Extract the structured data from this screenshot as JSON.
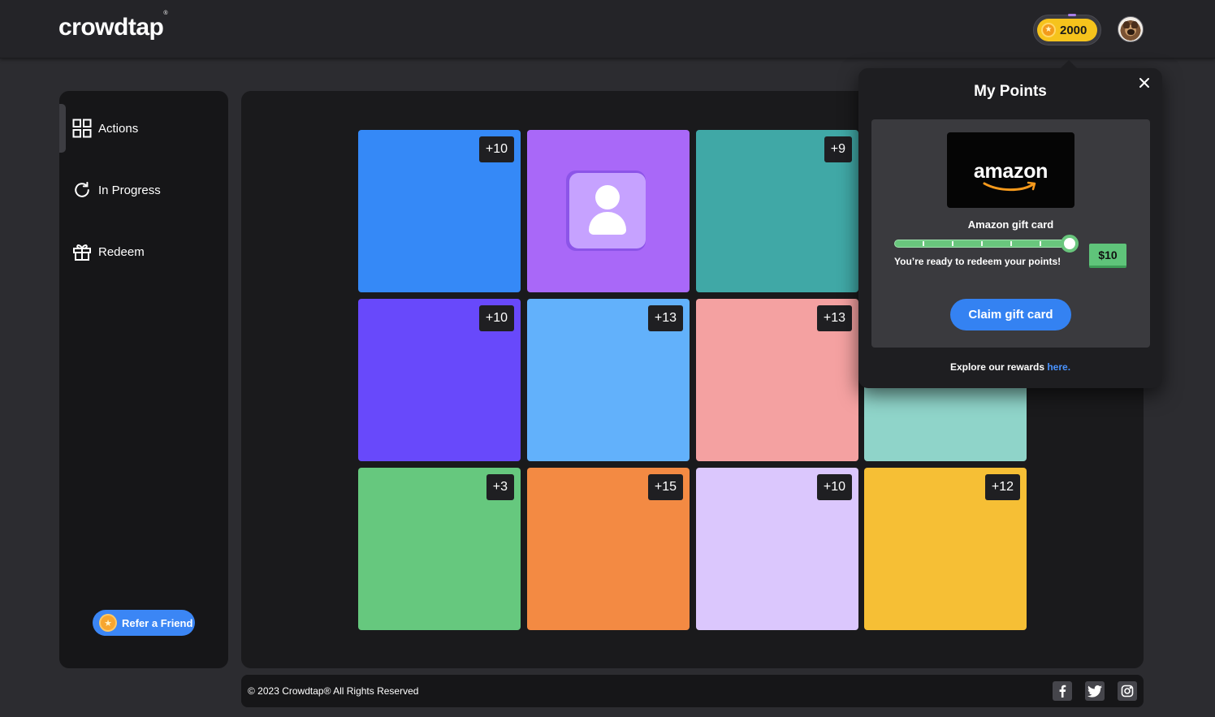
{
  "header": {
    "logo_text": "crowdtap",
    "logo_mark": "®",
    "points": "2000",
    "coin_icon": "star-coin-icon"
  },
  "sidebar": {
    "items": [
      {
        "label": "Actions",
        "icon": "grid-icon"
      },
      {
        "label": "In Progress",
        "icon": "refresh-icon"
      },
      {
        "label": "Redeem",
        "icon": "gift-icon"
      }
    ],
    "refer_label": "Refer a Friend"
  },
  "tiles": [
    {
      "color": "#3589f7",
      "badge": "+10"
    },
    {
      "color": "#a968f8",
      "badge": ""
    },
    {
      "color": "#40a8a6",
      "badge": "+9"
    },
    {
      "color": "#6849fb",
      "badge": "+10"
    },
    {
      "color": "#62b1fb",
      "badge": "+13"
    },
    {
      "color": "#f4a1a1",
      "badge": "+13"
    },
    {
      "color": "#8fd4c9",
      "badge": ""
    },
    {
      "color": "#66c87e",
      "badge": "+3"
    },
    {
      "color": "#f38a43",
      "badge": "+15"
    },
    {
      "color": "#dbc7fd",
      "badge": "+10"
    },
    {
      "color": "#f6bf35",
      "badge": "+12"
    }
  ],
  "popover": {
    "title": "My Points",
    "card_brand": "amazon",
    "card_label": "Amazon gift card",
    "progress": 1.0,
    "ready_text": "You’re ready to redeem your points!",
    "price": "$10",
    "claim_label": "Claim gift card",
    "explore_text": "Explore our rewards ",
    "explore_link": "here."
  },
  "footer": {
    "copyright": "© 2023 Crowdtap® All Rights Reserved",
    "social": [
      "facebook-icon",
      "twitter-icon",
      "instagram-icon"
    ]
  }
}
